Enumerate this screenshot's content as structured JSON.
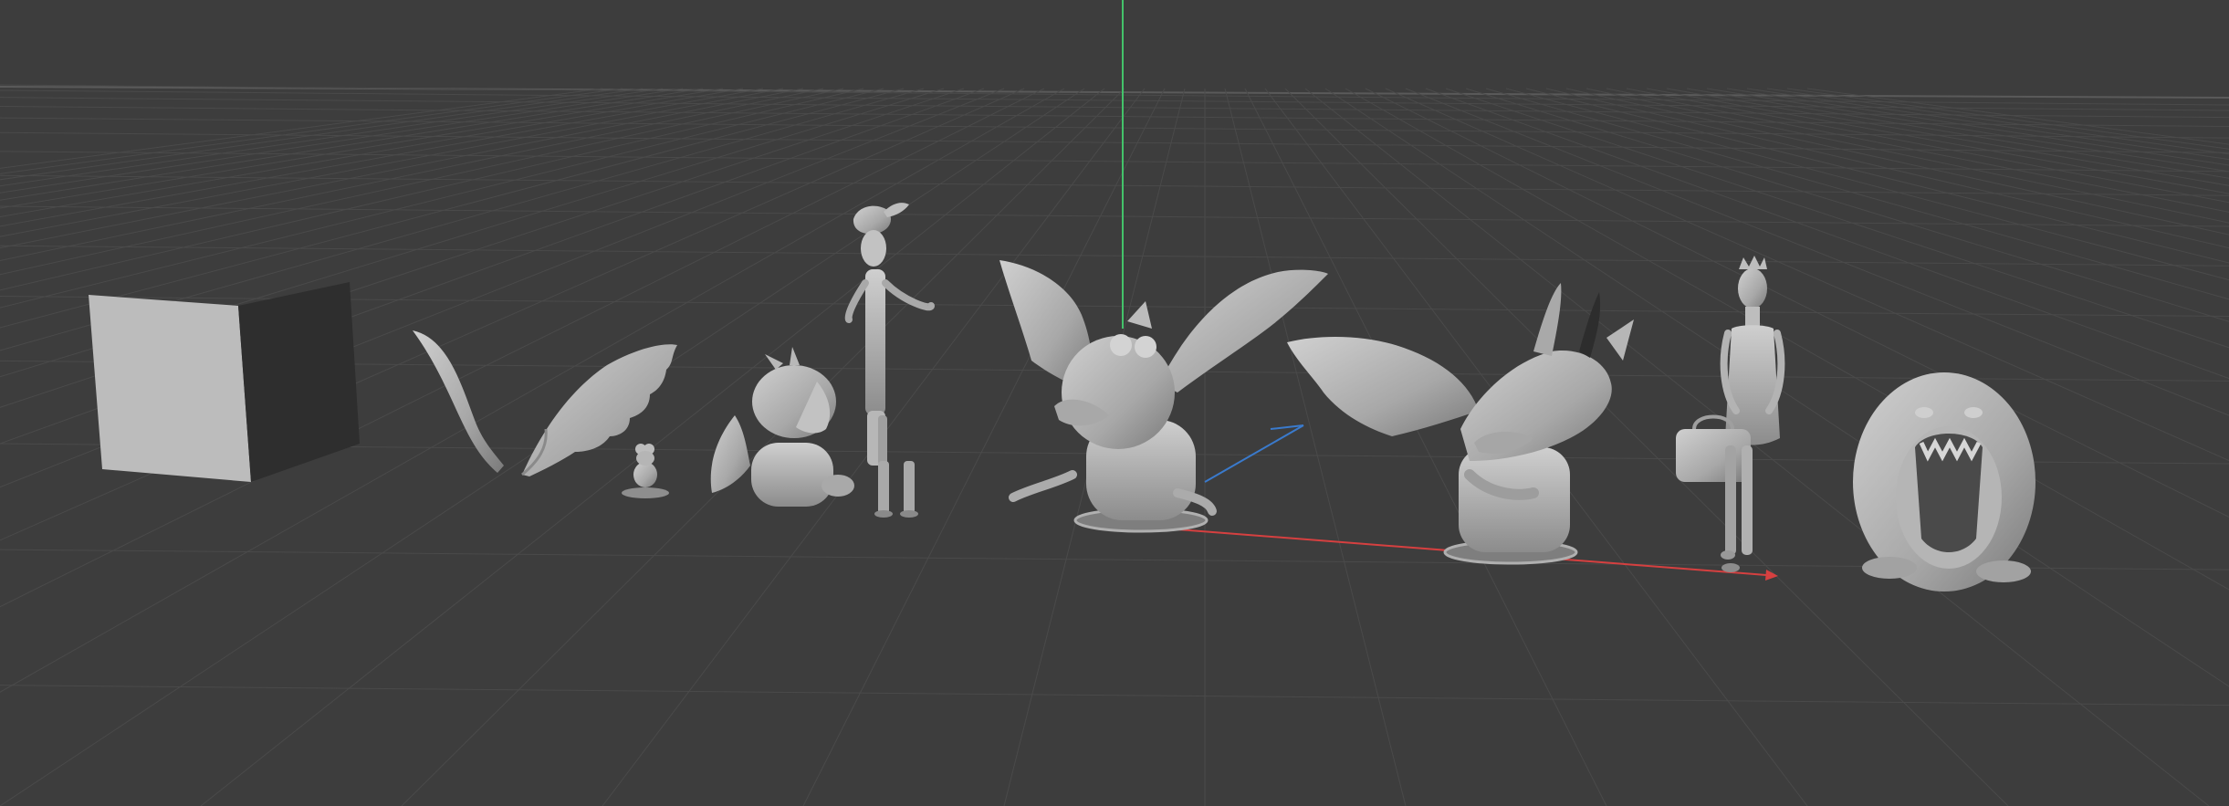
{
  "app": {
    "name": "3D viewport",
    "shading": "solid"
  },
  "colors": {
    "background": "#3d3d3d",
    "grid_line": "#4a4a4a",
    "horizon": "#5a5a5a",
    "axis_x": "#d64040",
    "axis_y": "#3a7acc",
    "axis_z": "#43c26a",
    "clay_light": "#c8c8c8",
    "clay_mid": "#9a9a9a",
    "clay_dark": "#5c5c5c"
  },
  "scene_objects": [
    {
      "id": "cube",
      "icon": "cube-mesh"
    },
    {
      "id": "wing-left-loose",
      "icon": "wing-mesh"
    },
    {
      "id": "wing-right-loose",
      "icon": "wing-mesh"
    },
    {
      "id": "small-frog",
      "icon": "frog-mesh"
    },
    {
      "id": "baby-dragon",
      "icon": "dragon-mesh"
    },
    {
      "id": "tall-man-feather-hat",
      "icon": "character-mesh"
    },
    {
      "id": "big-dragon-front",
      "icon": "dragon-mesh"
    },
    {
      "id": "dragon-side-base",
      "icon": "dragon-mesh"
    },
    {
      "id": "princess-with-crown",
      "icon": "character-mesh"
    },
    {
      "id": "roaring-lion",
      "icon": "lion-mesh"
    }
  ]
}
